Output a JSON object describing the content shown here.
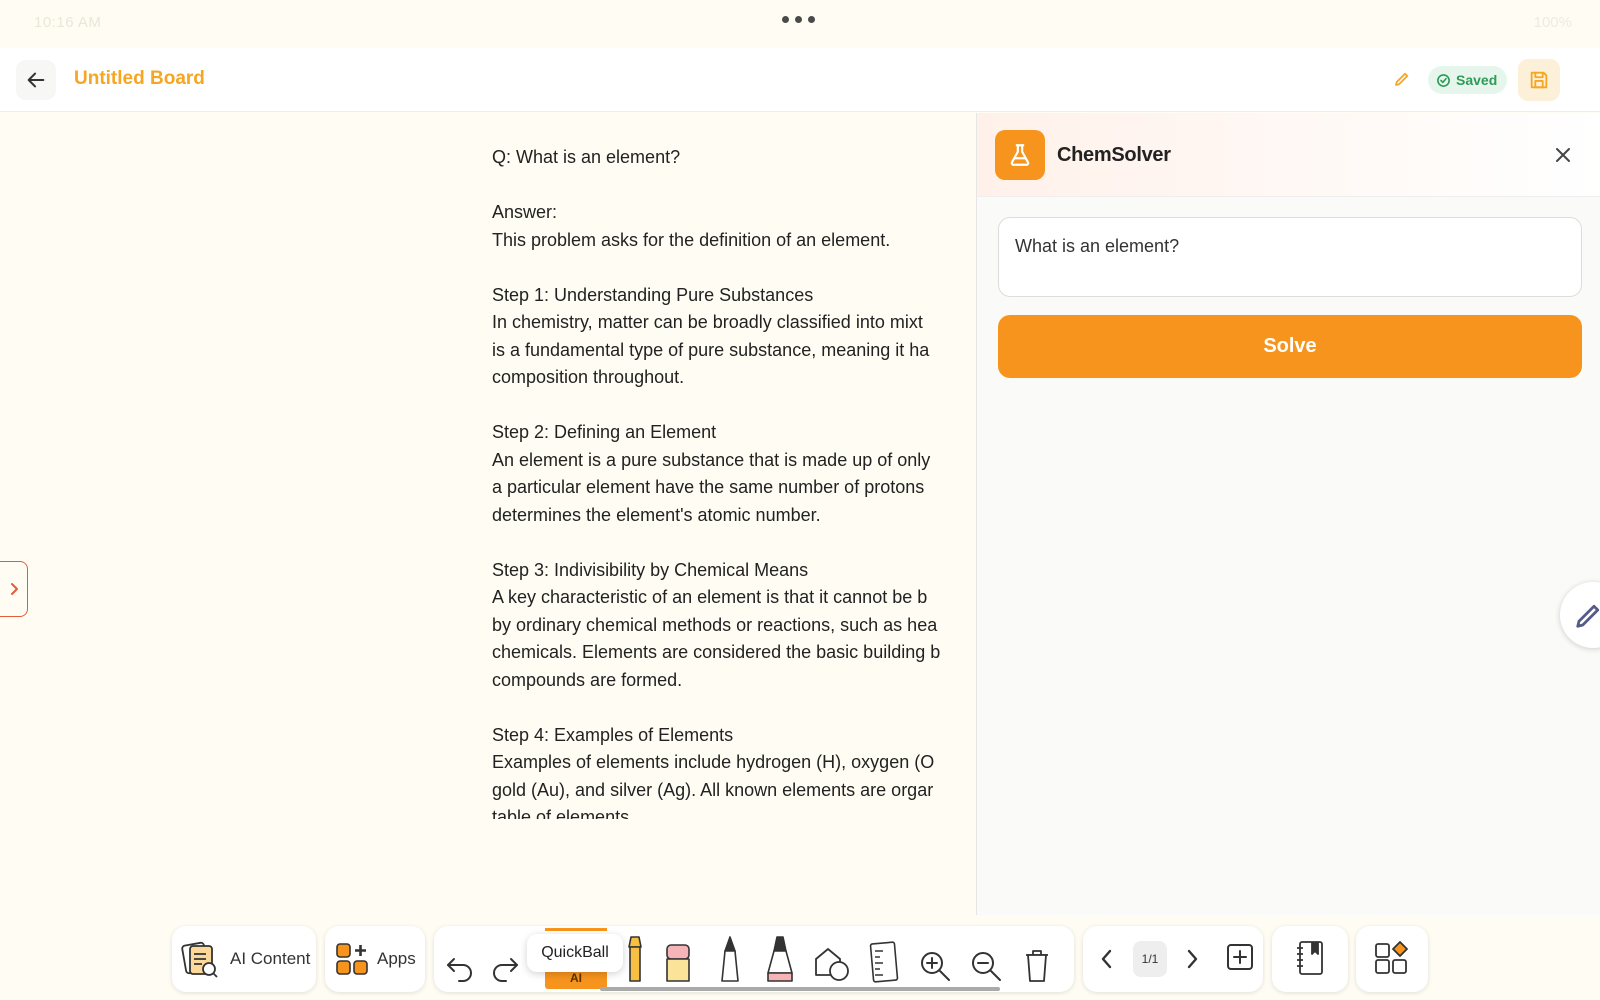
{
  "status_bar": {
    "time": "10:16 AM",
    "battery": "100%"
  },
  "header": {
    "title": "Untitled Board",
    "saved_label": "Saved"
  },
  "answer_lines": [
    "Q: What is an element?",
    "",
    "Answer:",
    "This problem asks for the definition of an element.",
    "",
    "Step 1: Understanding Pure Substances",
    "In chemistry, matter can be broadly classified into mixt",
    "is a fundamental type of pure substance, meaning it ha",
    "composition throughout.",
    "",
    "Step 2: Defining an Element",
    "An element is a pure substance that is made up of only",
    "a particular element have the same number of protons",
    "determines the element's atomic number.",
    "",
    "Step 3: Indivisibility by Chemical Means",
    "A key characteristic of an element is that it cannot be b",
    "by ordinary chemical methods or reactions, such as hea",
    "chemicals. Elements are considered the basic building b",
    "compounds are formed.",
    "",
    "Step 4: Examples of Elements",
    "Examples of elements include hydrogen (H), oxygen (O",
    "gold (Au), and silver (Ag). All known elements are orgar",
    "table of elements"
  ],
  "panel": {
    "title": "ChemSolver",
    "question_value": "What is an element?",
    "solve_label": "Solve"
  },
  "toolbar": {
    "ai_content_label": "AI Content",
    "apps_label": "Apps",
    "tooltip": "QuickBall",
    "ai_tab": "AI",
    "page_indicator": "1/1"
  },
  "colors": {
    "accent": "#f7941d",
    "title_orange": "#f5a623",
    "saved_green": "#2e9b57",
    "toggle_red": "#e45a3a"
  }
}
